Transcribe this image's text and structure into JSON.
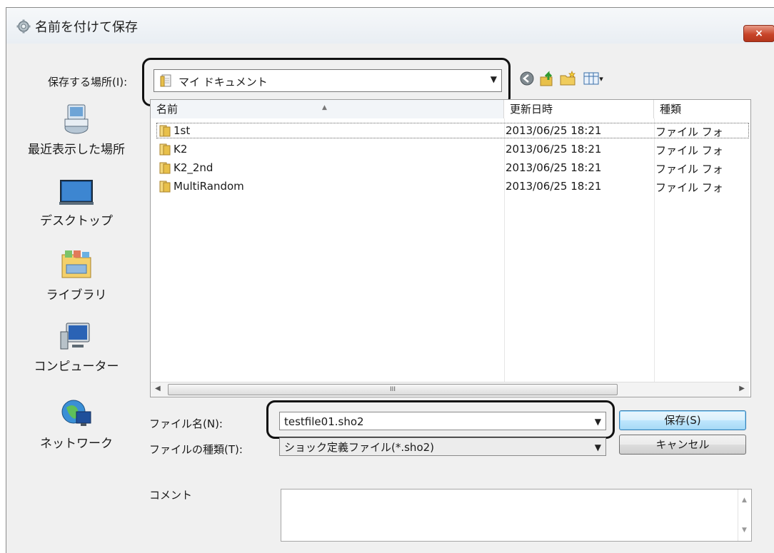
{
  "dialog": {
    "title": "名前を付けて保存",
    "close_label": "×"
  },
  "location": {
    "label": "保存する場所(I):",
    "value": "マイ ドキュメント"
  },
  "toolbar": {
    "icons": [
      "back-icon",
      "up-folder-icon",
      "new-folder-icon",
      "view-menu-icon"
    ],
    "view_menu_arrow": "▾"
  },
  "places": [
    {
      "label": "最近表示した場所",
      "icon": "recent-places-icon"
    },
    {
      "label": "デスクトップ",
      "icon": "desktop-icon"
    },
    {
      "label": "ライブラリ",
      "icon": "libraries-icon"
    },
    {
      "label": "コンピューター",
      "icon": "computer-icon"
    },
    {
      "label": "ネットワーク",
      "icon": "network-icon"
    }
  ],
  "file_list": {
    "columns": [
      "名前",
      "更新日時",
      "種類"
    ],
    "rows": [
      {
        "name": "1st",
        "date": "2013/06/25 18:21",
        "type": "ファイル フォ"
      },
      {
        "name": "K2",
        "date": "2013/06/25 18:21",
        "type": "ファイル フォ"
      },
      {
        "name": "K2_2nd",
        "date": "2013/06/25 18:21",
        "type": "ファイル フォ"
      },
      {
        "name": "MultiRandom",
        "date": "2013/06/25 18:21",
        "type": "ファイル フォ"
      }
    ],
    "scroll_thumb_grip": "III"
  },
  "form": {
    "filename_label": "ファイル名(N):",
    "filename_value": "testfile01.sho2",
    "filetype_label": "ファイルの種類(T):",
    "filetype_value": "ショック定義ファイル(*.sho2)",
    "save_button": "保存(S)",
    "cancel_button": "キャンセル",
    "comment_label": "コメント",
    "comment_value": ""
  },
  "colors": {
    "callout_border": "#111111",
    "close_button": "#c8452a",
    "folder": "#e8c04a"
  }
}
